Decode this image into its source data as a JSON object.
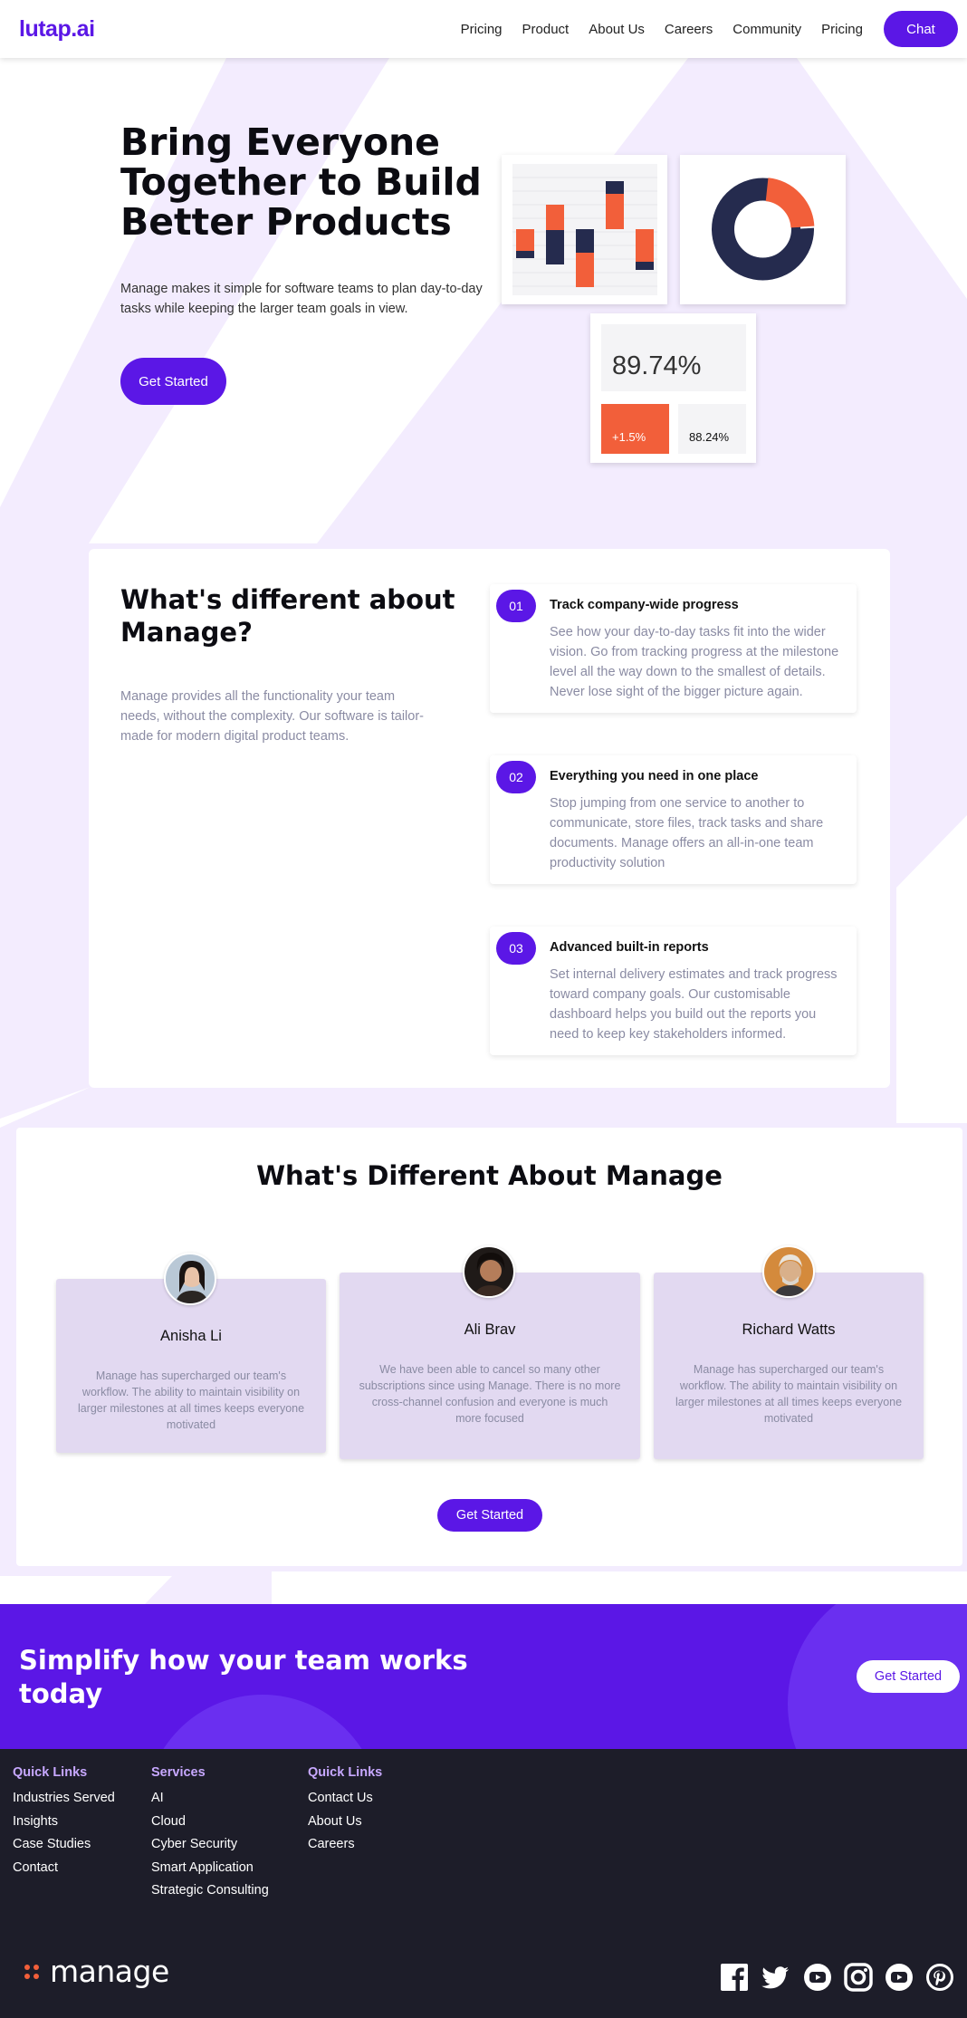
{
  "nav": {
    "logo": "lutap.ai",
    "links": [
      "Pricing",
      "Product",
      "About Us",
      "Careers",
      "Community",
      "Pricing"
    ],
    "chat": "Chat"
  },
  "hero": {
    "title": "Bring Everyone Together to Build Better Products",
    "subtitle": "Manage makes it simple for software teams to plan day-to-day tasks while keeping the larger team goals in view.",
    "cta": "Get Started",
    "stat_main": "89.74%",
    "stat_change": "+1.5%",
    "stat_secondary": "88.24%"
  },
  "different": {
    "title": "What's different about Manage?",
    "subtitle": "Manage provides all the functionality your team needs, without the complexity. Our software is tailor-made for modern digital product teams.",
    "features": [
      {
        "num": "01",
        "title": "Track company-wide progress",
        "desc": "See how your day-to-day tasks fit into the wider vision. Go from tracking progress at the milestone level all the way down to the smallest of details. Never lose sight of the bigger picture again."
      },
      {
        "num": "02",
        "title": "Everything you need in one place",
        "desc": "Stop jumping from one service to another to communicate, store files, track tasks and share documents. Manage offers an all-in-one team productivity solution"
      },
      {
        "num": "03",
        "title": "Advanced built-in reports",
        "desc": "Set internal delivery estimates and track progress toward company goals. Our customisable dashboard helps you build out the reports you need to keep key stakeholders informed."
      }
    ]
  },
  "testimonials": {
    "title": "What's Different About Manage",
    "items": [
      {
        "name": "Anisha Li",
        "quote": "Manage has supercharged our team's workflow. The ability to maintain visibility on larger milestones at all times keeps everyone motivated"
      },
      {
        "name": "Ali Brav",
        "quote": "We have been able to cancel so many other subscriptions since using Manage. There is no more cross-channel confusion and everyone is much more focused"
      },
      {
        "name": "Richard Watts",
        "quote": "Manage has supercharged our team's workflow. The ability to maintain visibility on larger milestones at all times keeps everyone motivated"
      }
    ],
    "cta": "Get Started"
  },
  "cta": {
    "title": "Simplify how your team works today",
    "button": "Get Started"
  },
  "footer": {
    "col1": {
      "heading": "Quick Links",
      "links": [
        "Industries Served",
        "Insights",
        "Case Studies",
        "Contact"
      ]
    },
    "col2": {
      "heading": "Services",
      "links": [
        "AI",
        "Cloud",
        "Cyber Security",
        "Smart Application",
        "Strategic Consulting"
      ]
    },
    "col3": {
      "heading": "Quick Links",
      "links": [
        "Contact Us",
        "About Us",
        "Careers"
      ]
    },
    "logo": "manage",
    "social_icons": [
      "facebook-icon",
      "twitter-icon",
      "youtube-icon",
      "instagram-icon",
      "youtube-icon",
      "pinterest-icon"
    ]
  },
  "colors": {
    "accent": "#5b17e6",
    "orange": "#f25f3a",
    "navy": "#252b4e",
    "footer_bg": "#1d1d29"
  }
}
